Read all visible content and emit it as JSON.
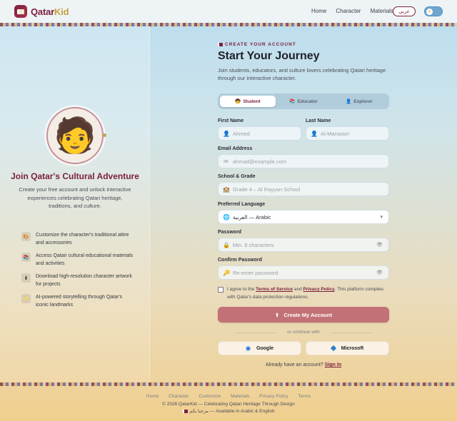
{
  "header": {
    "logo_part1": "Qatar",
    "logo_part2": "Kid",
    "nav": [
      "Home",
      "Character",
      "Materials"
    ],
    "lang_button": "عربي",
    "theme_icon": "☀"
  },
  "left": {
    "avatar": "🧑",
    "title": "Join Qatar's Cultural Adventure",
    "subtitle": "Create your free account and unlock interactive experiences celebrating Qatari heritage, traditions, and culture.",
    "features": [
      {
        "icon": "🎨",
        "text": "Customize the character's traditional attire and accessories"
      },
      {
        "icon": "📚",
        "text": "Access Qatari cultural educational materials and activities"
      },
      {
        "icon": "⬇",
        "text": "Download high-resolution character artwork for projects"
      },
      {
        "icon": "✨",
        "text": "AI-powered storytelling through Qatar's iconic landmarks"
      }
    ]
  },
  "form": {
    "eyebrow": "CREATE YOUR ACCOUNT",
    "title": "Start Your Journey",
    "subtitle": "Join students, educators, and culture lovers celebrating Qatari heritage through our interactive character.",
    "roles": [
      {
        "icon": "🧒",
        "label": "Student"
      },
      {
        "icon": "📚",
        "label": "Educator"
      },
      {
        "icon": "👤",
        "label": "Explorer"
      }
    ],
    "first_name_label": "First Name",
    "first_name_placeholder": "Ahmed",
    "last_name_label": "Last Name",
    "last_name_placeholder": "Al-Mansoori",
    "email_label": "Email Address",
    "email_placeholder": "ahmad@example.com",
    "school_label": "School & Grade",
    "school_placeholder": "Grade 4 – Al Rayyan School",
    "language_label": "Preferred Language",
    "language_value": "العربية — Arabic",
    "password_label": "Password",
    "password_placeholder": "Min. 8 characters",
    "confirm_label": "Confirm Password",
    "confirm_placeholder": "Re-enter password",
    "agree_prefix": "I agree to the ",
    "terms_link": "Terms of Service",
    "agree_and": " and ",
    "privacy_link": "Privacy Policy",
    "agree_suffix": ". This platform complies with Qatar's data protection regulations.",
    "create_button": "Create My Account",
    "or_text": "or continue with",
    "google": "Google",
    "microsoft": "Microsoft",
    "signin_prefix": "Already have an account?",
    "signin_link": "Sign In"
  },
  "footer": {
    "links": [
      "Home",
      "Character",
      "Customize",
      "Materials",
      "Privacy Policy",
      "Terms"
    ],
    "copyright": "© 2026 QatarKid — Celebrating Qatari Heritage Through Design",
    "availability": "مرحبا بكم — Available in Arabic & English"
  },
  "colors": {
    "brand": "#7a1f3d",
    "accent_gold": "#c4a23c",
    "button": "#c27276"
  }
}
